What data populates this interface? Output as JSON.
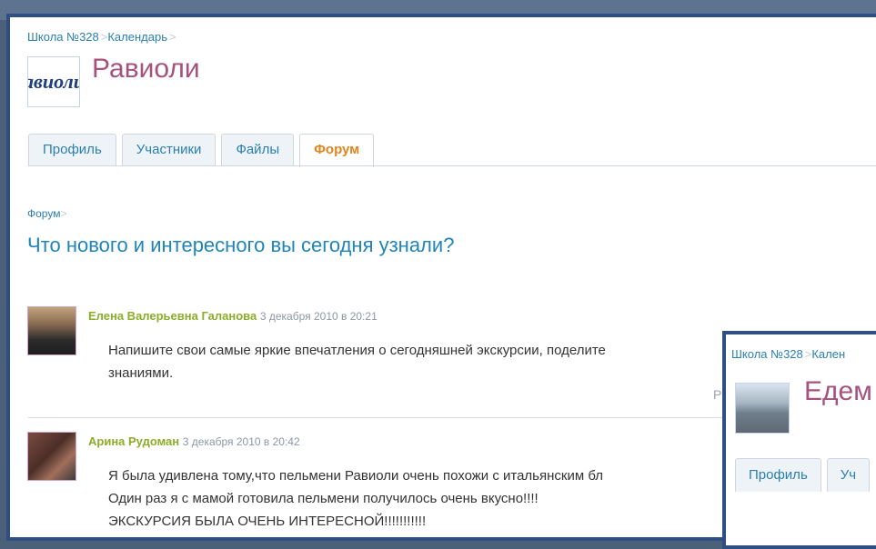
{
  "window1": {
    "breadcrumb": {
      "school": "Школа №328",
      "calendar": "Календарь",
      "separator": ">"
    },
    "logo_text": "авиоли",
    "group_title": "Равиоли",
    "tabs": [
      {
        "label": "Профиль"
      },
      {
        "label": "Участники"
      },
      {
        "label": "Файлы"
      },
      {
        "label": "Форум",
        "active": true
      }
    ],
    "forum_crumb": "Форум",
    "forum_separator": ">",
    "topic_title": "Что нового и интересного вы сегодня узнали?",
    "posts": [
      {
        "author": "Елена Валерьевна Галанова",
        "date": "3 декабря 2010 в 20:21",
        "lines": [
          "Напишите свои самые яркие впечатления о сегодняшней экскурсии, поделите",
          "знаниями."
        ],
        "reply_fragment": "Р"
      },
      {
        "author": "Арина Рудоман",
        "date": "3 декабря 2010 в 20:42",
        "lines": [
          "Я была удивлена тому,что пельмени Равиоли очень похожи с итальянским бл",
          "Один раз я с мамой готовила пельмени получилось очень вкусно!!!!",
          "ЭКСКУРСИЯ БЫЛА ОЧЕНЬ ИНТЕРЕСНОЙ!!!!!!!!!!!"
        ]
      }
    ]
  },
  "window2": {
    "breadcrumb": {
      "school": "Школа №328",
      "calendar_fragment": "Кален",
      "separator": ">"
    },
    "group_title_fragment": "Едем",
    "tabs": [
      {
        "label": "Профиль"
      },
      {
        "label": "Уч"
      }
    ]
  },
  "colors": {
    "frame": "#2f4e84",
    "link": "#2a7fb0",
    "group_title": "#a5527f",
    "active_tab": "#e2841c",
    "author": "#8cad2a"
  }
}
